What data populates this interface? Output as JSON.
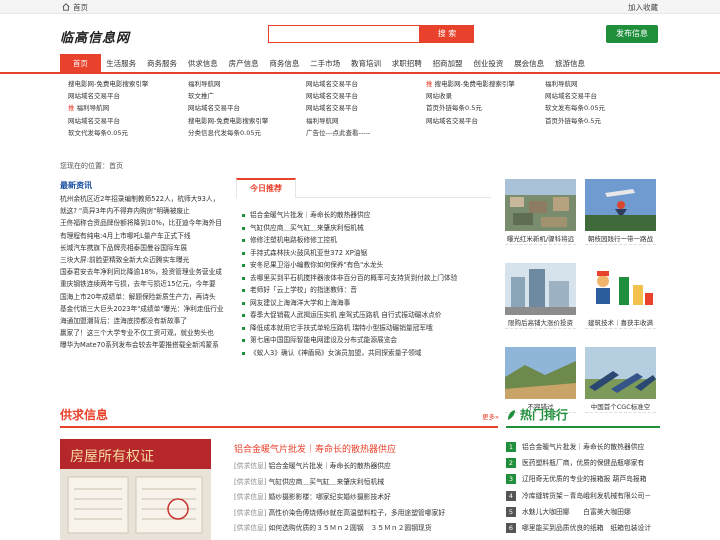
{
  "topbar": {
    "home": "首页",
    "favorite": "加入收藏"
  },
  "header": {
    "logo": "临高信息网",
    "search_button": "搜 索",
    "search_placeholder": "",
    "publish_button": "发布信息"
  },
  "nav": [
    "首页",
    "生活服务",
    "商务服务",
    "供求信息",
    "房产信息",
    "商务信息",
    "二手市场",
    "教育培训",
    "求职招聘",
    "招商加盟",
    "创业投资",
    "展会信息",
    "旅游信息"
  ],
  "ads": {
    "col1": [
      {
        "tag": "",
        "text": "搜电影网-免费电影搜索引擎"
      },
      {
        "tag": "",
        "text": "网站域名交易平台"
      },
      {
        "tag": "推",
        "text": "福利导航网"
      },
      {
        "tag": "",
        "text": "网站域名交易平台"
      },
      {
        "tag": "",
        "text": "软文代发每条0.05元"
      }
    ],
    "col2": [
      {
        "tag": "",
        "text": "福利导航网"
      },
      {
        "tag": "",
        "text": "软文推广"
      },
      {
        "tag": "",
        "text": "网站域名交易平台"
      },
      {
        "tag": "",
        "text": "搜电影网-免费电影搜索引擎"
      },
      {
        "tag": "",
        "text": "分类信息代发每条0.05元"
      }
    ],
    "col3": [
      {
        "tag": "",
        "text": "网站域名交易平台"
      },
      {
        "tag": "",
        "text": "网站域名交易平台"
      },
      {
        "tag": "",
        "text": "网站域名交易平台"
      },
      {
        "tag": "",
        "text": "福利导航网"
      },
      {
        "tag": "",
        "text": "广告位---点此查看-----"
      }
    ],
    "col4": [
      {
        "tag": "推",
        "text": "搜电影网-免费电影搜索引擎"
      },
      {
        "tag": "",
        "text": "网站收录"
      },
      {
        "tag": "",
        "text": "首页外链每条0.5元"
      },
      {
        "tag": "",
        "text": "网站域名交易平台"
      }
    ],
    "col5": [
      {
        "tag": "",
        "text": "福利导航网"
      },
      {
        "tag": "",
        "text": "网站域名交易平台"
      },
      {
        "tag": "",
        "text": "软文发布每条0.05元"
      },
      {
        "tag": "",
        "text": "首页外链每条0.5元"
      }
    ]
  },
  "breadcrumb": "您现在的位置：首页",
  "latest": {
    "title": "最新资讯",
    "lines": [
      "杭州余杭区近2年招录编制教师522人，杭师大93人，",
      "就这? \"高异3年内不得弃内购房\"明确被废止",
      "王佟福称合资品牌份额将降到10%，比亚迪今年海外目",
      "有理程有纯电:4月上市哪吒L量产车正式下线",
      "长城汽车携旗下品牌亮相泰国曼谷国际车展",
      "三块大屏:前脸更精致全新大众迈腾实车曝光",
      "国泰君安去年净利同比降逾18%，投资管理业务营业成",
      "重庆钢铁连续两年亏损，去年亏损近15亿元，今年要",
      "国海上市20年成绩单：解题保险新质生产力，再诗头",
      "基金代销三大巨头2023年\"成绩单\"曝光：净利走低行业",
      "海通加盟潮背后：连海底捞都没有新故事了",
      "赢家了！这三个大学专业不仅工资可观，就业势头也",
      "曝华为Mate70系列发布会较去年要推搭载全新鸿蒙系"
    ]
  },
  "recommend": {
    "tab": "今日推荐",
    "items": [
      "铝合金暖气片批发｜寿命长的散热器供应",
      "气缸供应商＿买气缸＿来肇庆利恒机械",
      "修修注塑机电路板修修工控机",
      "手持式森林扶火鼓风机亚世372 XP油锯",
      "安冬尼果卫浴小编教你如何保养\"有色\"水龙头",
      "去哪里买到平石机搅拌器液体非百分百的概率可支持货到付款上门体验",
      "老师好「云上学校」的指迷教师：音",
      "网友建议上海海洋大学和上海海事",
      "春季大促销载人武揭运压实机 座驾式压路机 自行式振动碾冰点价",
      "降低成本就用它手扶式单轮压路机 瑞特小型振动碾销量冠军哦",
      "第七届中国国际智能电网建设及分布式能源展览会",
      "《蚁人3》确认《神盾局》女演员加盟，共同探索量子领域"
    ]
  },
  "gallery": [
    {
      "caption": "曝光红米新机/骤科将远"
    },
    {
      "caption": "朝枝园践行一带一路战"
    },
    {
      "caption": "限购后高铺大涨价投资"
    },
    {
      "caption": "建筑技术｜喜获丰收满"
    },
    {
      "caption": "不容错过"
    },
    {
      "caption": "中国首个CGC标准空"
    }
  ],
  "supply": {
    "title": "供求信息",
    "more": "更多»",
    "headline": "铝合金暖气片批发｜寿命长的散热器供应",
    "items": [
      {
        "cat": "[供求信息]",
        "text": "铝合金暖气片批发｜寿命长的散热器供应"
      },
      {
        "cat": "[供求信息]",
        "text": "气缸供应商＿买气缸＿来肇庆利恒机械"
      },
      {
        "cat": "[供求信息]",
        "text": "婚纱摄影影楼：哪家纪实婚纱摄影技术好"
      },
      {
        "cat": "[供求信息]",
        "text": "高性价染色傅烧傅纱就在高温塑料粒子，多用途塑管哪家好"
      },
      {
        "cat": "[供求信息]",
        "text": "如何选购优质的３５Ｍｎ２圆钢　３５Ｍｎ２圆钢现货"
      }
    ],
    "image_text": "房屋所有权证"
  },
  "hot": {
    "title": "热门排行",
    "items": [
      {
        "n": "1",
        "text": "铝合金暖气片批发｜寿命长的散热器供应"
      },
      {
        "n": "2",
        "text": "医药塑料瓶厂商，优质的保健品瓶哪家有"
      },
      {
        "n": "3",
        "text": "辽阳奇无优质的专业的报箱报 葫芦岛报箱"
      },
      {
        "n": "4",
        "text": "冷库缝转货架－青岛峨利发机械有限公司－"
      },
      {
        "n": "5",
        "text": "水魅儿大咖田娜　　白富美大咖田娜"
      },
      {
        "n": "6",
        "text": "哪里能买到品质优良的纸箱　纸箱包装设计"
      }
    ]
  },
  "colors": {
    "accent": "#e8412c",
    "green": "#1f8f3c"
  }
}
